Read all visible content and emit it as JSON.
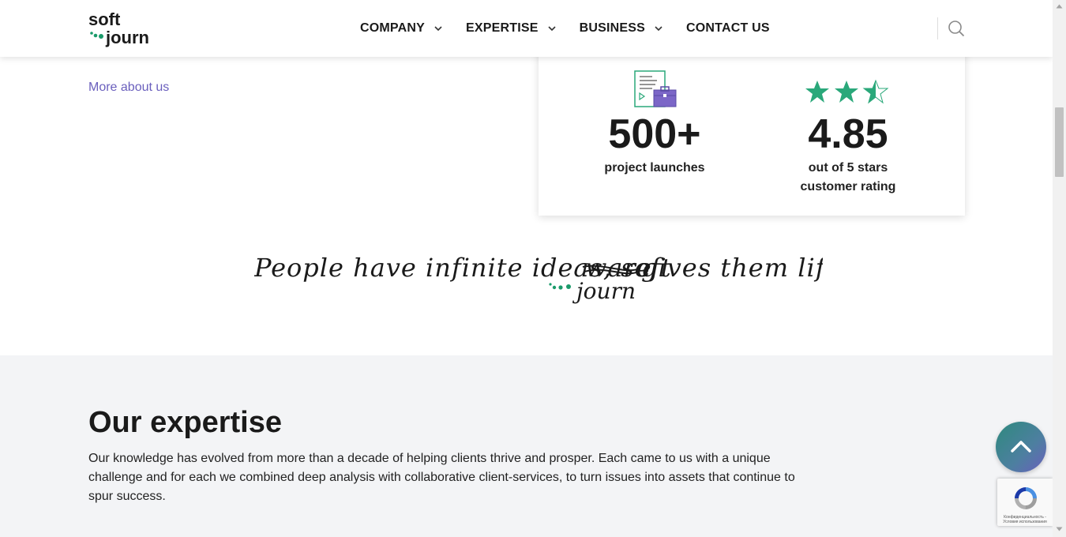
{
  "brand": {
    "logo_top": "soft",
    "logo_bottom": "journ",
    "colors": {
      "green": "#1a9a6a",
      "purple": "#6a5fbd",
      "star": "#2aa87a"
    }
  },
  "nav": {
    "items": [
      {
        "label": "COMPANY",
        "has_dropdown": true
      },
      {
        "label": "EXPERTISE",
        "has_dropdown": true
      },
      {
        "label": "BUSINESS",
        "has_dropdown": true
      },
      {
        "label": "CONTACT US",
        "has_dropdown": false
      }
    ],
    "search_icon": "search-icon"
  },
  "about": {
    "more_link": "More about us"
  },
  "stats": {
    "launches": {
      "value": "500+",
      "label": "project launches",
      "icon": "document-briefcase-icon"
    },
    "rating": {
      "value": "4.85",
      "label_line1": "out of 5 stars",
      "label_line2": "customer rating",
      "stars": 2.5,
      "max_stars": 3
    }
  },
  "tagline": {
    "text_before": "People have infinite ideas, soft",
    "struck_word": "ware",
    "text_after": "gives them life!",
    "replacement": "journ"
  },
  "expertise": {
    "title": "Our expertise",
    "description": "Our knowledge has evolved from more than a decade of helping clients thrive and prosper. Each came to us with a unique challenge and for each we combined deep analysis with collaborative client-services, to turn issues into assets that continue to spur success."
  },
  "widgets": {
    "scroll_top_icon": "chevron-up-icon",
    "recaptcha_text": "Конфиденциальность - Условия использования"
  }
}
